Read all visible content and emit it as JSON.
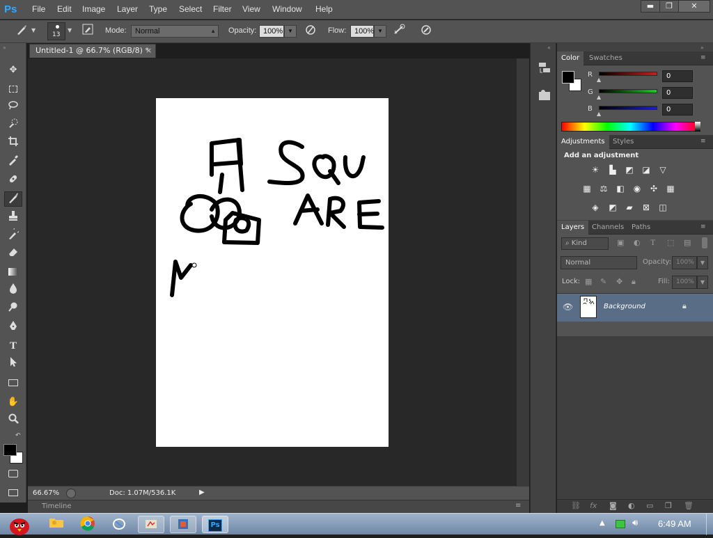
{
  "app": {
    "logo": "Ps",
    "accent": "#31a8ff"
  },
  "menu": [
    "File",
    "Edit",
    "Image",
    "Layer",
    "Type",
    "Select",
    "Filter",
    "View",
    "Window",
    "Help"
  ],
  "window_controls": {
    "minimize": "▬",
    "restore": "❐",
    "close": "✕"
  },
  "options": {
    "brush_size": "13",
    "mode_label": "Mode:",
    "mode_value": "Normal",
    "opacity_label": "Opacity:",
    "opacity_value": "100%",
    "flow_label": "Flow:",
    "flow_value": "100%"
  },
  "document": {
    "tab_title": "Untitled-1 @ 66.7% (RGB/8) *",
    "close_glyph": "×"
  },
  "status": {
    "zoom": "66.67%",
    "doc_info": "Doc: 1.07M/536.1K"
  },
  "timeline": {
    "label": "Timeline"
  },
  "color_panel": {
    "tabs": [
      "Color",
      "Swatches"
    ],
    "r_label": "R",
    "g_label": "G",
    "b_label": "B",
    "r_value": "0",
    "g_value": "0",
    "b_value": "0",
    "colors": {
      "r": "#c81e1e",
      "g": "#1ec81e",
      "b": "#1e1ec8"
    }
  },
  "adjustments_panel": {
    "tabs": [
      "Adjustments",
      "Styles"
    ],
    "heading": "Add an adjustment"
  },
  "layers_panel": {
    "tabs": [
      "Layers",
      "Channels",
      "Paths"
    ],
    "filter_kind": "Kind",
    "blend_mode": "Normal",
    "opacity_label": "Opacity:",
    "opacity_value": "100%",
    "lock_label": "Lock:",
    "fill_label": "Fill:",
    "fill_value": "100%",
    "layers": [
      {
        "name": "Background",
        "visible": true,
        "locked": true
      }
    ]
  },
  "taskbar": {
    "clock": "6:49 AM"
  }
}
